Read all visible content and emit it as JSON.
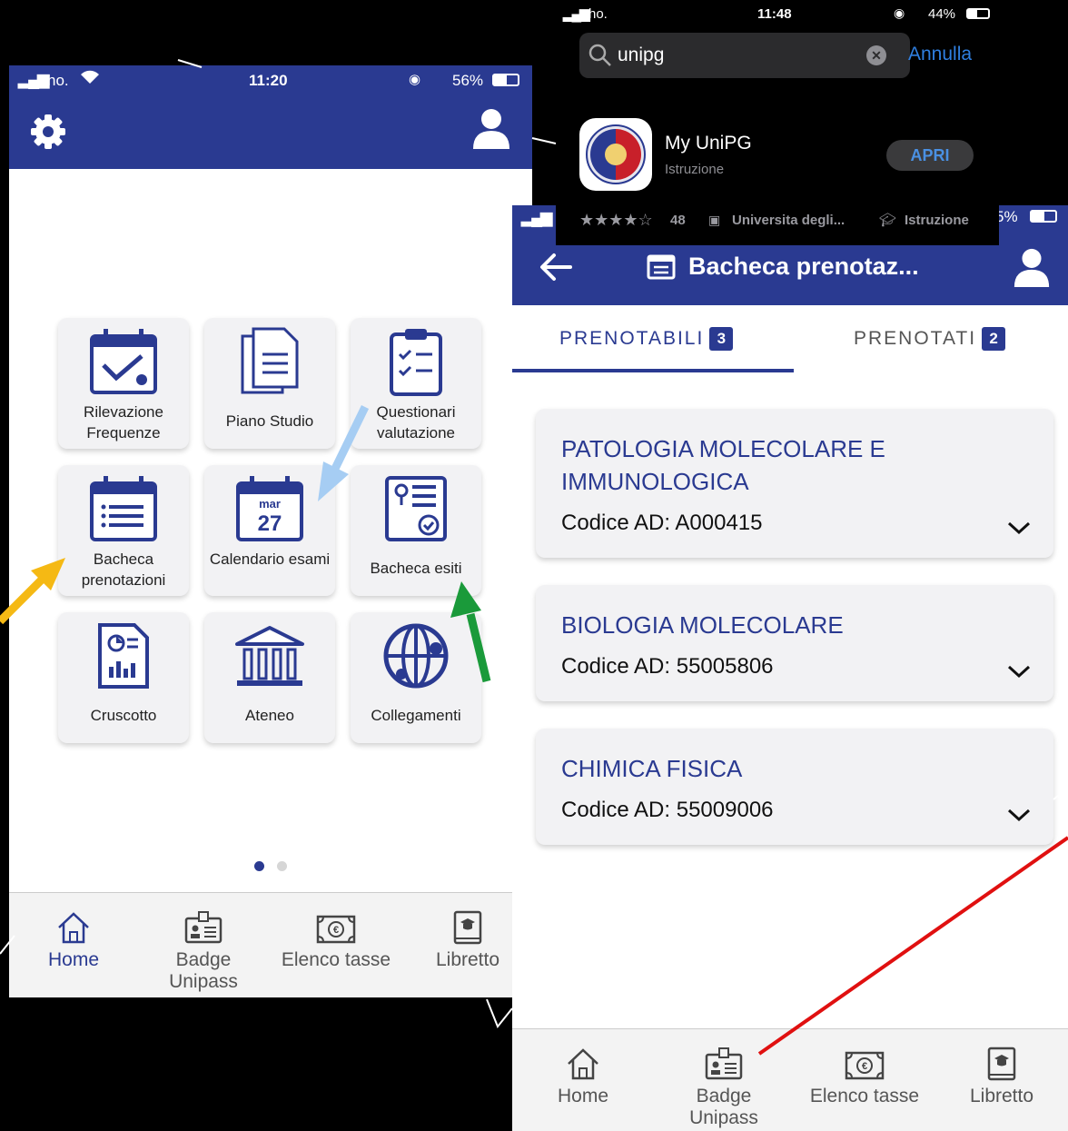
{
  "left_phone": {
    "status": {
      "carrier": "ho.",
      "time": "11:20",
      "battery": "56%"
    },
    "tiles": [
      {
        "label": "Rilevazione Frequenze",
        "icon": "calendar-check-icon"
      },
      {
        "label": "Piano Studio",
        "icon": "documents-icon"
      },
      {
        "label": "Questionari valutazione",
        "icon": "clipboard-checklist-icon"
      },
      {
        "label": "Bacheca prenotazioni",
        "icon": "calendar-list-icon"
      },
      {
        "label": "Calendario esami",
        "icon": "calendar-date-icon",
        "cal_day": "mar",
        "cal_num": "27"
      },
      {
        "label": "Bacheca esiti",
        "icon": "results-board-icon"
      },
      {
        "label": "Cruscotto",
        "icon": "dashboard-report-icon"
      },
      {
        "label": "Ateneo",
        "icon": "university-building-icon"
      },
      {
        "label": "Collegamenti",
        "icon": "globe-links-icon"
      }
    ],
    "page_dots": {
      "count": 2,
      "active": 0
    },
    "nav": [
      {
        "label": "Home",
        "icon": "home-icon",
        "active": true
      },
      {
        "label": "Badge Unipass",
        "icon": "badge-icon",
        "active": false
      },
      {
        "label": "Elenco tasse",
        "icon": "money-icon",
        "active": false
      },
      {
        "label": "Libretto",
        "icon": "booklet-icon",
        "active": false
      }
    ]
  },
  "right_phone": {
    "status": {
      "battery": "55%",
      "battery_visible": "5%"
    },
    "header": {
      "title": "Bacheca prenotaz..."
    },
    "tabs": [
      {
        "label": "PRENOTABILI",
        "count": "3",
        "active": true
      },
      {
        "label": "PRENOTATI",
        "count": "2",
        "active": false
      }
    ],
    "cards": [
      {
        "title_line1": "PATOLOGIA MOLECOLARE E",
        "title_line2": "IMMUNOLOGICA",
        "code": "Codice AD: A000415"
      },
      {
        "title_line1": "BIOLOGIA MOLECOLARE",
        "title_line2": "",
        "code": "Codice AD: 55005806"
      },
      {
        "title_line1": "CHIMICA FISICA",
        "title_line2": "",
        "code": "Codice AD: 55009006"
      }
    ],
    "nav": [
      {
        "label": "Home",
        "icon": "home-icon"
      },
      {
        "label": "Badge Unipass",
        "icon": "badge-icon"
      },
      {
        "label": "Elenco tasse",
        "icon": "money-icon"
      },
      {
        "label": "Libretto",
        "icon": "booklet-icon"
      }
    ]
  },
  "store": {
    "status": {
      "carrier": "ho.",
      "time": "11:48",
      "battery": "44%"
    },
    "search_value": "unipg",
    "cancel_label": "Annulla",
    "app_name": "My UniPG",
    "app_category": "Istruzione",
    "open_label": "APRI",
    "rating_stars": "★★★★☆",
    "rating_count": "48",
    "developer": "Universita degli...",
    "category_tag": "Istruzione"
  },
  "colors": {
    "primary": "#2a3a91",
    "arrow_yellow": "#f5b914",
    "arrow_blue": "#a6cdf3",
    "arrow_green": "#1a9a3a",
    "arrow_red": "#e01010"
  }
}
